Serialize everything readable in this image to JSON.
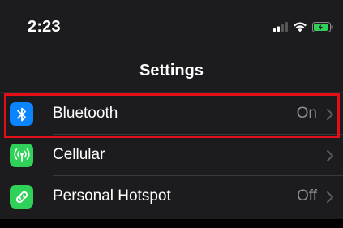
{
  "status_bar": {
    "time": "2:23",
    "icons": [
      "signal-icon",
      "wifi-icon",
      "battery-charging-icon"
    ]
  },
  "nav": {
    "title": "Settings"
  },
  "settings": [
    {
      "label": "Bluetooth",
      "value": "On",
      "icon": "bluetooth-icon",
      "icon_color": "#0a84ff",
      "highlighted": true
    },
    {
      "label": "Cellular",
      "value": "",
      "icon": "antenna-icon",
      "icon_color": "#30d158"
    },
    {
      "label": "Personal Hotspot",
      "value": "Off",
      "icon": "hotspot-link-icon",
      "icon_color": "#30d158"
    }
  ],
  "colors": {
    "background": "#1c1c1e",
    "highlight": "#e3101a",
    "secondary_text": "#8e8e93"
  }
}
